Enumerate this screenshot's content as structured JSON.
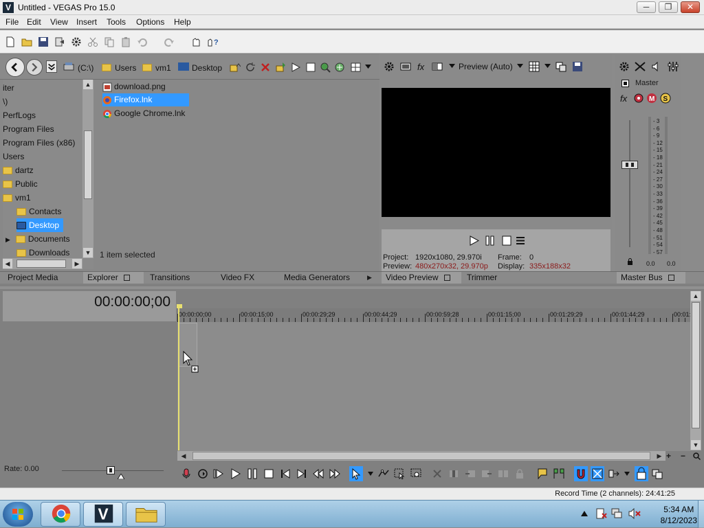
{
  "window": {
    "title": "Untitled - VEGAS Pro 15.0",
    "icon_letter": "V",
    "min": "─",
    "max": "❐",
    "close": "✕"
  },
  "menu": [
    "File",
    "Edit",
    "View",
    "Insert",
    "Tools",
    "Options",
    "Help"
  ],
  "explorer": {
    "breadcrumbs": [
      "(C:\\)",
      "Users",
      "vm1",
      "Desktop"
    ],
    "tree": [
      "iter",
      "\\)",
      "PerfLogs",
      "Program Files",
      "Program Files (x86)",
      "Users",
      "dartz",
      "Public",
      "vm1",
      "Contacts",
      "Desktop",
      "Documents",
      "Downloads"
    ],
    "files": [
      {
        "name": "download.png",
        "icon": "image-icon"
      },
      {
        "name": "Firefox.lnk",
        "icon": "firefox-icon"
      },
      {
        "name": "Google Chrome.lnk",
        "icon": "chrome-icon"
      }
    ],
    "status": "1 item selected"
  },
  "tabs": {
    "left": [
      "Project Media",
      "Explorer",
      "Transitions",
      "Video FX",
      "Media Generators"
    ],
    "preview": [
      "Video Preview",
      "Trimmer"
    ],
    "master": "Master Bus"
  },
  "preview": {
    "mode": "Preview (Auto)",
    "project_label": "Project:",
    "project_value": "1920x1080, 29.970i",
    "preview_label": "Preview:",
    "preview_value": "480x270x32, 29.970p",
    "frame_label": "Frame:",
    "frame_value": "0",
    "display_label": "Display:",
    "display_value": "335x188x32"
  },
  "master": {
    "label": "Master",
    "scale": [
      "3",
      "6",
      "9",
      "12",
      "15",
      "18",
      "21",
      "24",
      "27",
      "30",
      "33",
      "36",
      "39",
      "42",
      "45",
      "48",
      "51",
      "54",
      "57"
    ],
    "left_level": "0.0",
    "right_level": "0.0"
  },
  "timeline": {
    "timecode": "00:00:00;00",
    "ruler": [
      "00:00:00;00",
      "00:00:15;00",
      "00:00:29;29",
      "00:00:44;29",
      "00:00:59;28",
      "00:01:15;00",
      "00:01:29;29",
      "00:01:44;29",
      "00:01:"
    ],
    "rate": "Rate: 0.00"
  },
  "status": {
    "record_time": "Record Time (2 channels): 24:41:25"
  },
  "taskbar": {
    "time": "5:34 AM",
    "date": "8/12/2023"
  },
  "colors": {
    "selection": "#3399ff",
    "cursor": "#e8e070",
    "accent_red": "#8b1a1a"
  }
}
